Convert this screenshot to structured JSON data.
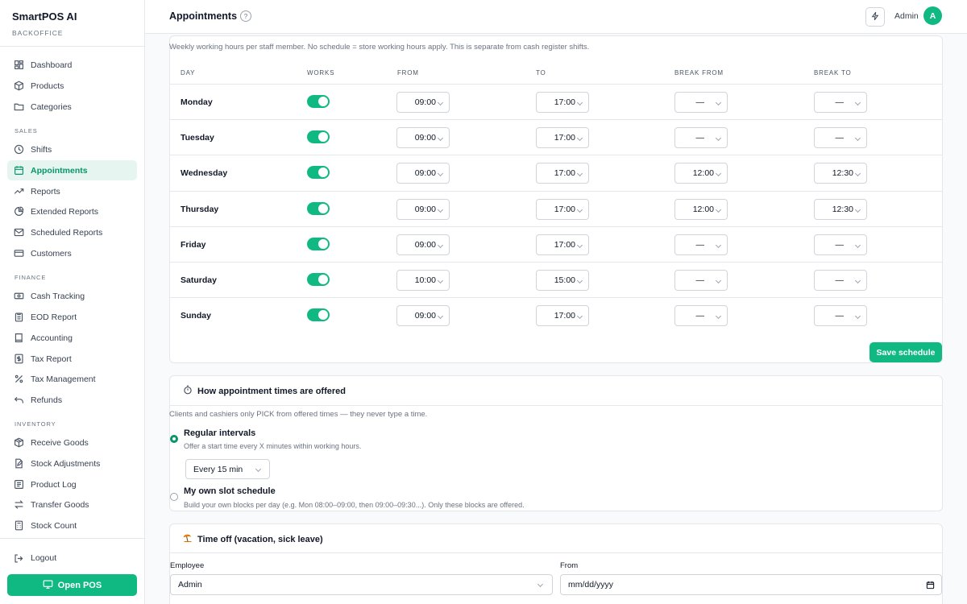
{
  "brand": {
    "name": "SmartPOS AI",
    "subtitle": "BACKOFFICE"
  },
  "sidebar": {
    "top_items": [
      {
        "label": "Dashboard",
        "icon": "dashboard-icon"
      },
      {
        "label": "Products",
        "icon": "box-icon"
      },
      {
        "label": "Categories",
        "icon": "folder-icon"
      }
    ],
    "sections": [
      {
        "title": "SALES",
        "items": [
          {
            "label": "Shifts",
            "icon": "clock-icon"
          },
          {
            "label": "Appointments",
            "icon": "calendar-icon",
            "active": true
          },
          {
            "label": "Reports",
            "icon": "trend-icon"
          },
          {
            "label": "Extended Reports",
            "icon": "pie-icon"
          },
          {
            "label": "Scheduled Reports",
            "icon": "mail-icon"
          },
          {
            "label": "Customers",
            "icon": "card-icon"
          }
        ]
      },
      {
        "title": "FINANCE",
        "items": [
          {
            "label": "Cash Tracking",
            "icon": "cash-icon"
          },
          {
            "label": "EOD Report",
            "icon": "clipboard-icon"
          },
          {
            "label": "Accounting",
            "icon": "book-icon"
          },
          {
            "label": "Tax Report",
            "icon": "dollar-doc-icon"
          },
          {
            "label": "Tax Management",
            "icon": "percent-icon"
          },
          {
            "label": "Refunds",
            "icon": "undo-icon"
          }
        ]
      },
      {
        "title": "INVENTORY",
        "items": [
          {
            "label": "Receive Goods",
            "icon": "package-icon"
          },
          {
            "label": "Stock Adjustments",
            "icon": "file-edit-icon"
          },
          {
            "label": "Product Log",
            "icon": "log-icon"
          },
          {
            "label": "Transfer Goods",
            "icon": "transfer-icon"
          },
          {
            "label": "Stock Count",
            "icon": "calculator-icon"
          }
        ]
      }
    ],
    "logout_label": "Logout",
    "open_pos_label": "Open POS"
  },
  "header": {
    "title": "Appointments",
    "help": "?",
    "user_name": "Admin",
    "avatar_initial": "A"
  },
  "schedule": {
    "description": "Weekly working hours per staff member. No schedule = store working hours apply. This is separate from cash register shifts.",
    "columns": [
      "DAY",
      "WORKS",
      "FROM",
      "TO",
      "BREAK FROM",
      "BREAK TO"
    ],
    "rows": [
      {
        "day": "Monday",
        "works": true,
        "from": "09:00",
        "to": "17:00",
        "break_from": "—",
        "break_to": "—"
      },
      {
        "day": "Tuesday",
        "works": true,
        "from": "09:00",
        "to": "17:00",
        "break_from": "—",
        "break_to": "—"
      },
      {
        "day": "Wednesday",
        "works": true,
        "from": "09:00",
        "to": "17:00",
        "break_from": "12:00",
        "break_to": "12:30"
      },
      {
        "day": "Thursday",
        "works": true,
        "from": "09:00",
        "to": "17:00",
        "break_from": "12:00",
        "break_to": "12:30"
      },
      {
        "day": "Friday",
        "works": true,
        "from": "09:00",
        "to": "17:00",
        "break_from": "—",
        "break_to": "—"
      },
      {
        "day": "Saturday",
        "works": true,
        "from": "10:00",
        "to": "15:00",
        "break_from": "—",
        "break_to": "—"
      },
      {
        "day": "Sunday",
        "works": true,
        "from": "09:00",
        "to": "17:00",
        "break_from": "—",
        "break_to": "—"
      }
    ],
    "save_label": "Save schedule"
  },
  "offering": {
    "title": "How appointment times are offered",
    "icon": "stopwatch-icon",
    "description": "Clients and cashiers only PICK from offered times — they never type a time.",
    "options": [
      {
        "title": "Regular intervals",
        "desc": "Offer a start time every X minutes within working hours.",
        "checked": true
      },
      {
        "title": "My own slot schedule",
        "desc": "Build your own blocks per day (e.g. Mon 08:00–09:00, then 09:00–09:30...). Only these blocks are offered.",
        "checked": false
      }
    ],
    "interval_value": "Every 15 min"
  },
  "time_off": {
    "title": "Time off (vacation, sick leave)",
    "icon": "beach-icon",
    "employee_label": "Employee",
    "employee_value": "Admin",
    "from_label": "From",
    "from_placeholder": "mm/dd/yyyy"
  },
  "colors": {
    "accent": "#10b981",
    "accent_dark": "#059669",
    "active_bg": "#e6f5f0"
  }
}
